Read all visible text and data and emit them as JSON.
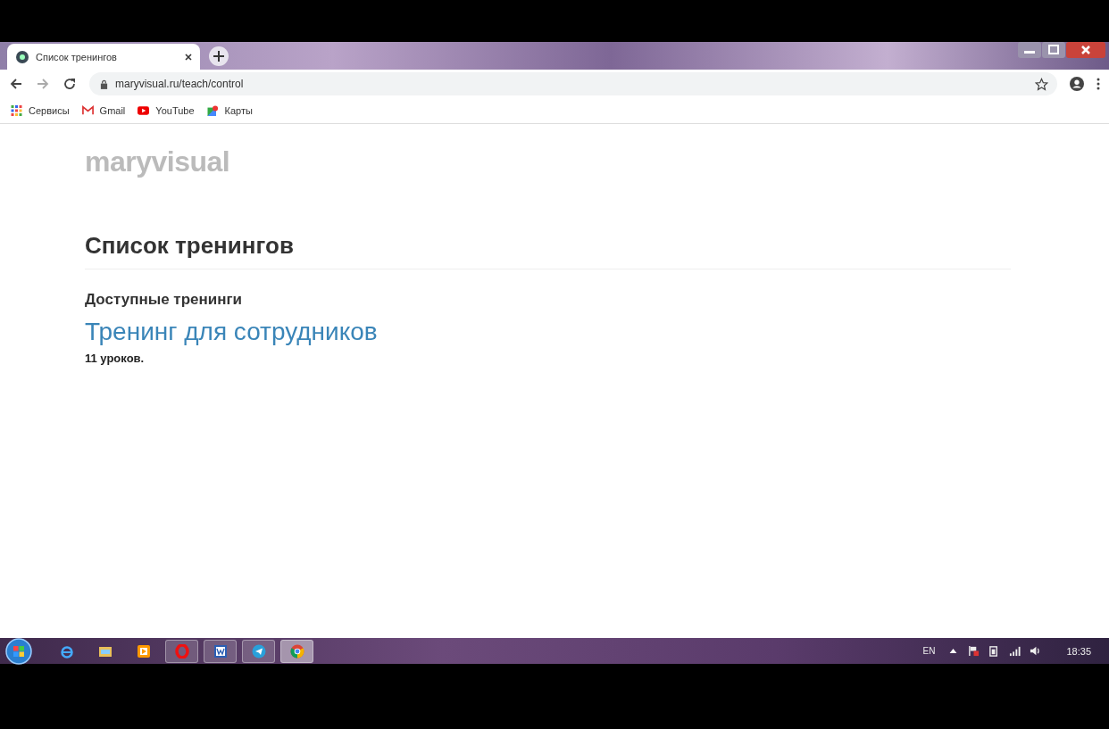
{
  "tab": {
    "title": "Список тренингов"
  },
  "address_bar": {
    "url": "maryvisual.ru/teach/control"
  },
  "bookmarks": [
    {
      "label": "Сервисы",
      "kind": "apps"
    },
    {
      "label": "Gmail",
      "kind": "gmail"
    },
    {
      "label": "YouTube",
      "kind": "youtube"
    },
    {
      "label": "Карты",
      "kind": "maps"
    }
  ],
  "page": {
    "logo": "maryvisual",
    "heading": "Список тренингов",
    "section": "Доступные тренинги",
    "trainings": [
      {
        "title": "Тренинг для сотрудников",
        "lessons": "11 уроков."
      }
    ]
  },
  "taskbar": {
    "apps": [
      {
        "kind": "ie",
        "running": false,
        "selected": false
      },
      {
        "kind": "folder",
        "running": false,
        "selected": false
      },
      {
        "kind": "player",
        "running": false,
        "selected": false
      },
      {
        "kind": "opera",
        "running": true,
        "selected": false
      },
      {
        "kind": "word",
        "running": true,
        "selected": false
      },
      {
        "kind": "telegram",
        "running": true,
        "selected": false
      },
      {
        "kind": "chrome",
        "running": true,
        "selected": true
      }
    ],
    "language": "EN",
    "clock": "18:35"
  }
}
